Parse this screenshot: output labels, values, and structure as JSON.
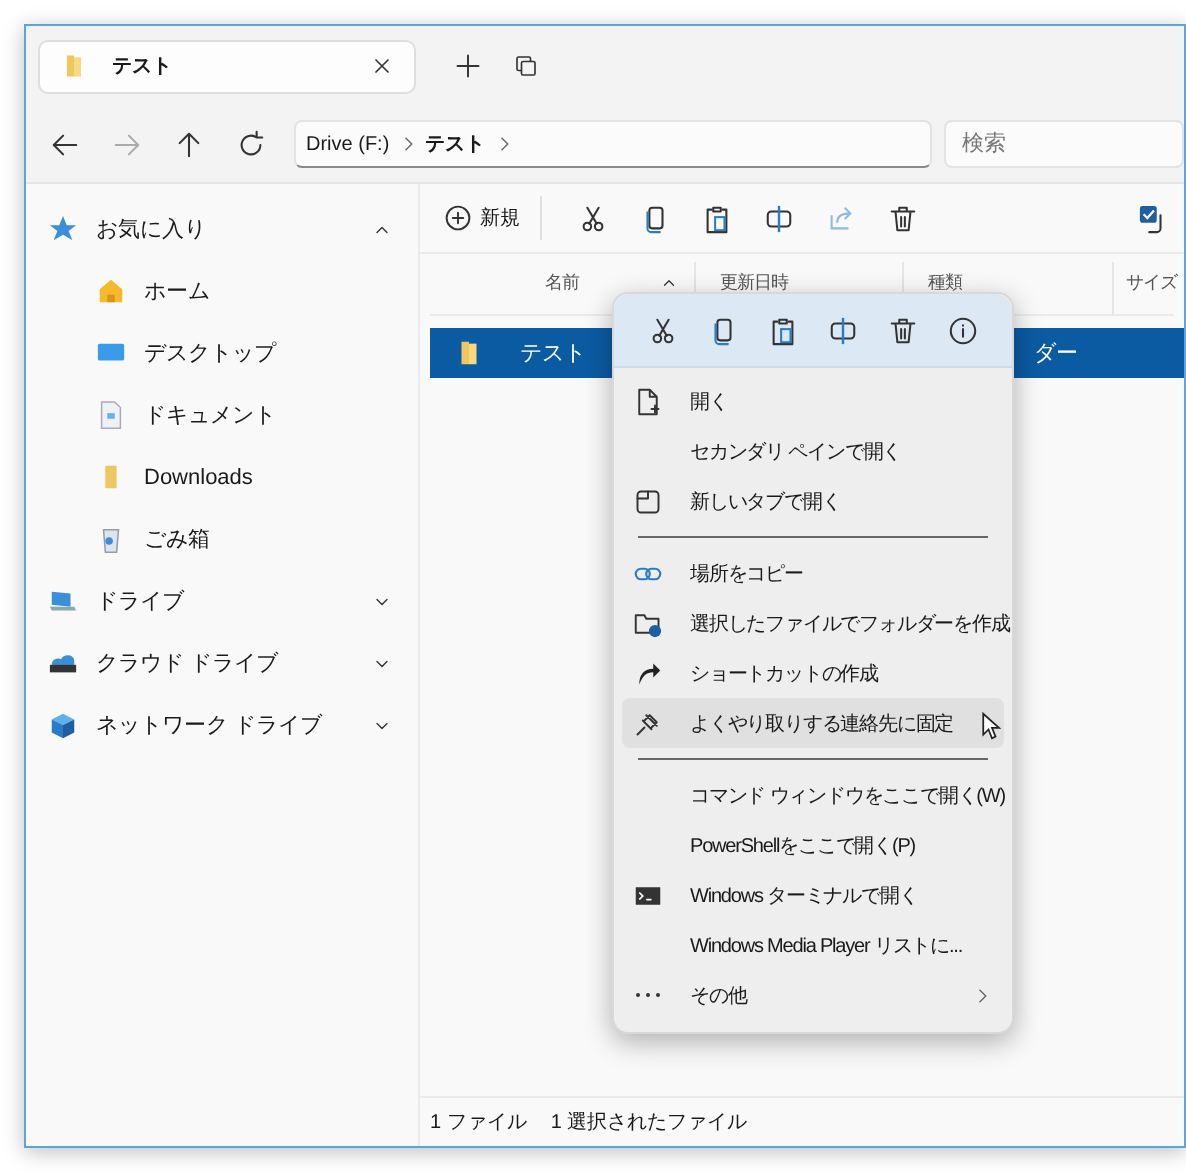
{
  "window": {
    "tabs": [
      {
        "title": "テスト",
        "selected": true
      }
    ]
  },
  "address": {
    "crumbs": [
      "Drive (F:)",
      "テスト"
    ]
  },
  "search": {
    "placeholder": "検索"
  },
  "sidebar": {
    "sections": [
      {
        "label": "お気に入り",
        "expanded": true,
        "children": [
          {
            "label": "ホーム"
          },
          {
            "label": "デスクトップ"
          },
          {
            "label": "ドキュメント"
          },
          {
            "label": "Downloads"
          },
          {
            "label": "ごみ箱"
          }
        ]
      },
      {
        "label": "ドライブ",
        "expanded": false
      },
      {
        "label": "クラウド ドライブ",
        "expanded": false
      },
      {
        "label": "ネットワーク ドライブ",
        "expanded": false
      }
    ]
  },
  "toolbar": {
    "new_label": "新規"
  },
  "table": {
    "columns": [
      {
        "label": "名前",
        "sorted": true
      },
      {
        "label": "更新日時",
        "sorted": false
      },
      {
        "label": "種類",
        "sorted": false
      },
      {
        "label": "サイズ",
        "sorted": false
      }
    ],
    "rows": [
      {
        "name": "テスト",
        "type": "ダー",
        "selected": true
      }
    ]
  },
  "context_menu": {
    "items": [
      {
        "kind": "item",
        "label": "開く",
        "hovered": false,
        "submenu": false
      },
      {
        "kind": "item",
        "label": "セカンダリ ペインで開く",
        "hovered": false,
        "submenu": false
      },
      {
        "kind": "item",
        "label": "新しいタブで開く",
        "hovered": false,
        "submenu": false
      },
      {
        "kind": "separator"
      },
      {
        "kind": "item",
        "label": "場所をコピー",
        "hovered": false,
        "submenu": false
      },
      {
        "kind": "item",
        "label": "選択したファイルでフォルダーを作成",
        "hovered": false,
        "submenu": false
      },
      {
        "kind": "item",
        "label": "ショートカットの作成",
        "hovered": false,
        "submenu": false
      },
      {
        "kind": "item",
        "label": "よくやり取りする連絡先に固定",
        "hovered": true,
        "submenu": false
      },
      {
        "kind": "separator"
      },
      {
        "kind": "item",
        "label": "コマンド ウィンドウをここで開く(W)",
        "hovered": false,
        "submenu": false
      },
      {
        "kind": "item",
        "label": "PowerShellをここで開く(P)",
        "hovered": false,
        "submenu": false
      },
      {
        "kind": "item",
        "label": "Windows ターミナルで開く",
        "hovered": false,
        "submenu": false
      },
      {
        "kind": "item",
        "label": "Windows Media Player リストに...",
        "hovered": false,
        "submenu": false
      },
      {
        "kind": "item",
        "label": "その他",
        "hovered": false,
        "submenu": true
      }
    ]
  },
  "status_bar": [
    "1 ファイル",
    "1 選択されたファイル"
  ]
}
